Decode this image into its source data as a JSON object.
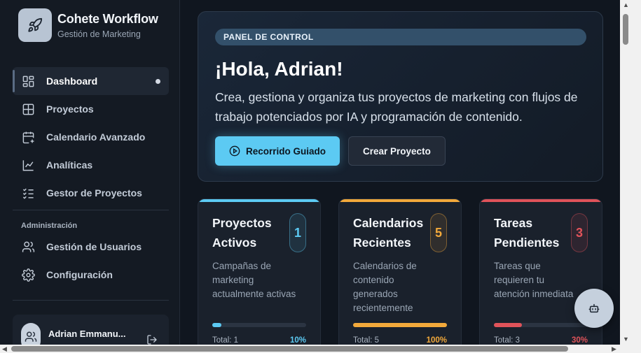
{
  "brand": {
    "title": "Cohete Workflow",
    "subtitle": "Gestión de Marketing"
  },
  "nav": {
    "items": [
      {
        "label": "Dashboard",
        "icon": "dashboard-icon",
        "active": true
      },
      {
        "label": "Proyectos",
        "icon": "grid-icon"
      },
      {
        "label": "Calendario Avanzado",
        "icon": "calendar-plus-icon"
      },
      {
        "label": "Analíticas",
        "icon": "line-chart-icon"
      },
      {
        "label": "Gestor de Proyectos",
        "icon": "checklist-icon"
      }
    ],
    "admin_label": "Administración",
    "admin_items": [
      {
        "label": "Gestión de Usuarios",
        "icon": "users-icon"
      },
      {
        "label": "Configuración",
        "icon": "gear-icon"
      }
    ]
  },
  "user": {
    "name": "Adrian Emmanu..."
  },
  "hero": {
    "badge": "PANEL DE CONTROL",
    "title": "¡Hola, Adrian!",
    "description": "Crea, gestiona y organiza tus proyectos de marketing con flujos de trabajo potenciados por IA y programación de contenido.",
    "primary_label": "Recorrido Guiado",
    "secondary_label": "Crear Proyecto"
  },
  "cards": [
    {
      "title": "Proyectos Activos",
      "count": "1",
      "description": "Campañas de marketing actualmente activas",
      "total": "Total: 1",
      "percent": "10%",
      "progress": 0.1,
      "accent": "#5ccaf3"
    },
    {
      "title": "Calendarios Recientes",
      "count": "5",
      "description": "Calendarios de contenido generados recientemente",
      "total": "Total: 5",
      "percent": "100%",
      "progress": 1.0,
      "accent": "#f2a93b"
    },
    {
      "title": "Tareas Pendientes",
      "count": "3",
      "description": "Tareas que requieren tu atención inmediata",
      "total": "Total: 3",
      "percent": "30%",
      "progress": 0.3,
      "accent": "#e0535a"
    }
  ],
  "colors": {
    "accent": "#5ccaf3",
    "background": "#10161f",
    "sidebar": "#141a23"
  }
}
